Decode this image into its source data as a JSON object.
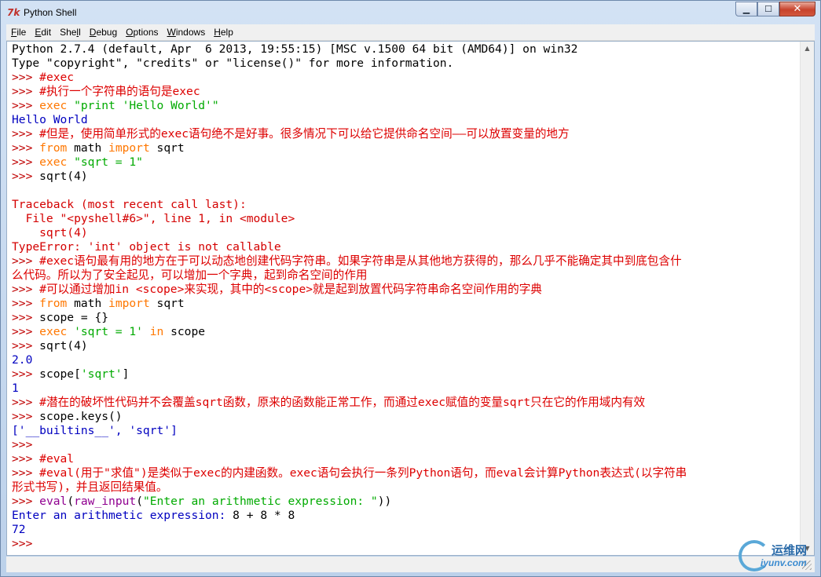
{
  "window": {
    "title": "Python Shell",
    "app_icon_glyph": "7k"
  },
  "menu": [
    {
      "key": "F",
      "rest": "ile"
    },
    {
      "key": "E",
      "rest": "dit"
    },
    {
      "key": "",
      "pre": "She",
      "key2": "l",
      "rest": "l"
    },
    {
      "key": "D",
      "rest": "ebug"
    },
    {
      "key": "O",
      "rest": "ptions"
    },
    {
      "key": "W",
      "rest": "indows"
    },
    {
      "key": "H",
      "rest": "elp"
    }
  ],
  "shell_lines": [
    [
      {
        "t": "Python 2.7.4 (default, Apr  6 2013, 19:55:15) [MSC v.1500 64 bit (AMD64)] on win32",
        "c": "o"
      }
    ],
    [
      {
        "t": "Type \"copyright\", \"credits\" or \"license()\" for more information.",
        "c": "o"
      }
    ],
    [
      {
        "t": ">>> ",
        "c": "p"
      },
      {
        "t": "#exec",
        "c": "cmt"
      }
    ],
    [
      {
        "t": ">>> ",
        "c": "p"
      },
      {
        "t": "#执行一个字符串的语句是exec",
        "c": "cmt"
      }
    ],
    [
      {
        "t": ">>> ",
        "c": "p"
      },
      {
        "t": "exec ",
        "c": "k"
      },
      {
        "t": "\"print 'Hello World'\"",
        "c": "s"
      }
    ],
    [
      {
        "t": "Hello World",
        "c": "blue"
      }
    ],
    [
      {
        "t": ">>> ",
        "c": "p"
      },
      {
        "t": "#但是，使用简单形式的exec语句绝不是好事。很多情况下可以给它提供命名空间——可以放置变量的地方",
        "c": "cmt"
      }
    ],
    [
      {
        "t": ">>> ",
        "c": "p"
      },
      {
        "t": "from ",
        "c": "k"
      },
      {
        "t": "math ",
        "c": "o"
      },
      {
        "t": "import ",
        "c": "k"
      },
      {
        "t": "sqrt",
        "c": "o"
      }
    ],
    [
      {
        "t": ">>> ",
        "c": "p"
      },
      {
        "t": "exec ",
        "c": "k"
      },
      {
        "t": "\"sqrt = 1\"",
        "c": "s"
      }
    ],
    [
      {
        "t": ">>> ",
        "c": "p"
      },
      {
        "t": "sqrt(4)",
        "c": "o"
      }
    ],
    [
      {
        "t": "",
        "c": "o"
      }
    ],
    [
      {
        "t": "Traceback (most recent call last):",
        "c": "err"
      }
    ],
    [
      {
        "t": "  File \"<pyshell#6>\", line 1, in <module>",
        "c": "err"
      }
    ],
    [
      {
        "t": "    sqrt(4)",
        "c": "err"
      }
    ],
    [
      {
        "t": "TypeError: 'int' object is not callable",
        "c": "err"
      }
    ],
    [
      {
        "t": ">>> ",
        "c": "p"
      },
      {
        "t": "#exec语句最有用的地方在于可以动态地创建代码字符串。如果字符串是从其他地方获得的，那么几乎不能确定其中到底包含什",
        "c": "cmt"
      }
    ],
    [
      {
        "t": "么代码。所以为了安全起见，可以增加一个字典，起到命名空间的作用",
        "c": "cmt"
      }
    ],
    [
      {
        "t": ">>> ",
        "c": "p"
      },
      {
        "t": "#可以通过增加in <scope>来实现，其中的<scope>就是起到放置代码字符串命名空间作用的字典",
        "c": "cmt"
      }
    ],
    [
      {
        "t": ">>> ",
        "c": "p"
      },
      {
        "t": "from ",
        "c": "k"
      },
      {
        "t": "math ",
        "c": "o"
      },
      {
        "t": "import ",
        "c": "k"
      },
      {
        "t": "sqrt",
        "c": "o"
      }
    ],
    [
      {
        "t": ">>> ",
        "c": "p"
      },
      {
        "t": "scope = {}",
        "c": "o"
      }
    ],
    [
      {
        "t": ">>> ",
        "c": "p"
      },
      {
        "t": "exec ",
        "c": "k"
      },
      {
        "t": "'sqrt = 1' ",
        "c": "s"
      },
      {
        "t": "in ",
        "c": "k"
      },
      {
        "t": "scope",
        "c": "o"
      }
    ],
    [
      {
        "t": ">>> ",
        "c": "p"
      },
      {
        "t": "sqrt(4)",
        "c": "o"
      }
    ],
    [
      {
        "t": "2.0",
        "c": "blue"
      }
    ],
    [
      {
        "t": ">>> ",
        "c": "p"
      },
      {
        "t": "scope[",
        "c": "o"
      },
      {
        "t": "'sqrt'",
        "c": "s"
      },
      {
        "t": "]",
        "c": "o"
      }
    ],
    [
      {
        "t": "1",
        "c": "blue"
      }
    ],
    [
      {
        "t": ">>> ",
        "c": "p"
      },
      {
        "t": "#潜在的破坏性代码并不会覆盖sqrt函数，原来的函数能正常工作，而通过exec赋值的变量sqrt只在它的作用域内有效",
        "c": "cmt"
      }
    ],
    [
      {
        "t": ">>> ",
        "c": "p"
      },
      {
        "t": "scope.keys()",
        "c": "o"
      }
    ],
    [
      {
        "t": "['__builtins__', 'sqrt']",
        "c": "blue"
      }
    ],
    [
      {
        "t": ">>> ",
        "c": "p"
      }
    ],
    [
      {
        "t": ">>> ",
        "c": "p"
      },
      {
        "t": "#eval",
        "c": "cmt"
      }
    ],
    [
      {
        "t": ">>> ",
        "c": "p"
      },
      {
        "t": "#eval(用于\"求值\")是类似于exec的内建函数。exec语句会执行一条列Python语句，而eval会计算Python表达式(以字符串",
        "c": "cmt"
      }
    ],
    [
      {
        "t": "形式书写)，并且返回结果值。",
        "c": "cmt"
      }
    ],
    [
      {
        "t": ">>> ",
        "c": "p"
      },
      {
        "t": "eval",
        "c": "b"
      },
      {
        "t": "(",
        "c": "o"
      },
      {
        "t": "raw_input",
        "c": "b"
      },
      {
        "t": "(",
        "c": "o"
      },
      {
        "t": "\"Enter an arithmetic expression: \"",
        "c": "s"
      },
      {
        "t": "))",
        "c": "o"
      }
    ],
    [
      {
        "t": "Enter an arithmetic expression: ",
        "c": "blue"
      },
      {
        "t": "8 + 8 * 8",
        "c": "o"
      }
    ],
    [
      {
        "t": "72",
        "c": "blue"
      }
    ],
    [
      {
        "t": ">>> ",
        "c": "p"
      }
    ]
  ],
  "watermark": {
    "line1": "运维网",
    "line2": "iyunv.com"
  }
}
